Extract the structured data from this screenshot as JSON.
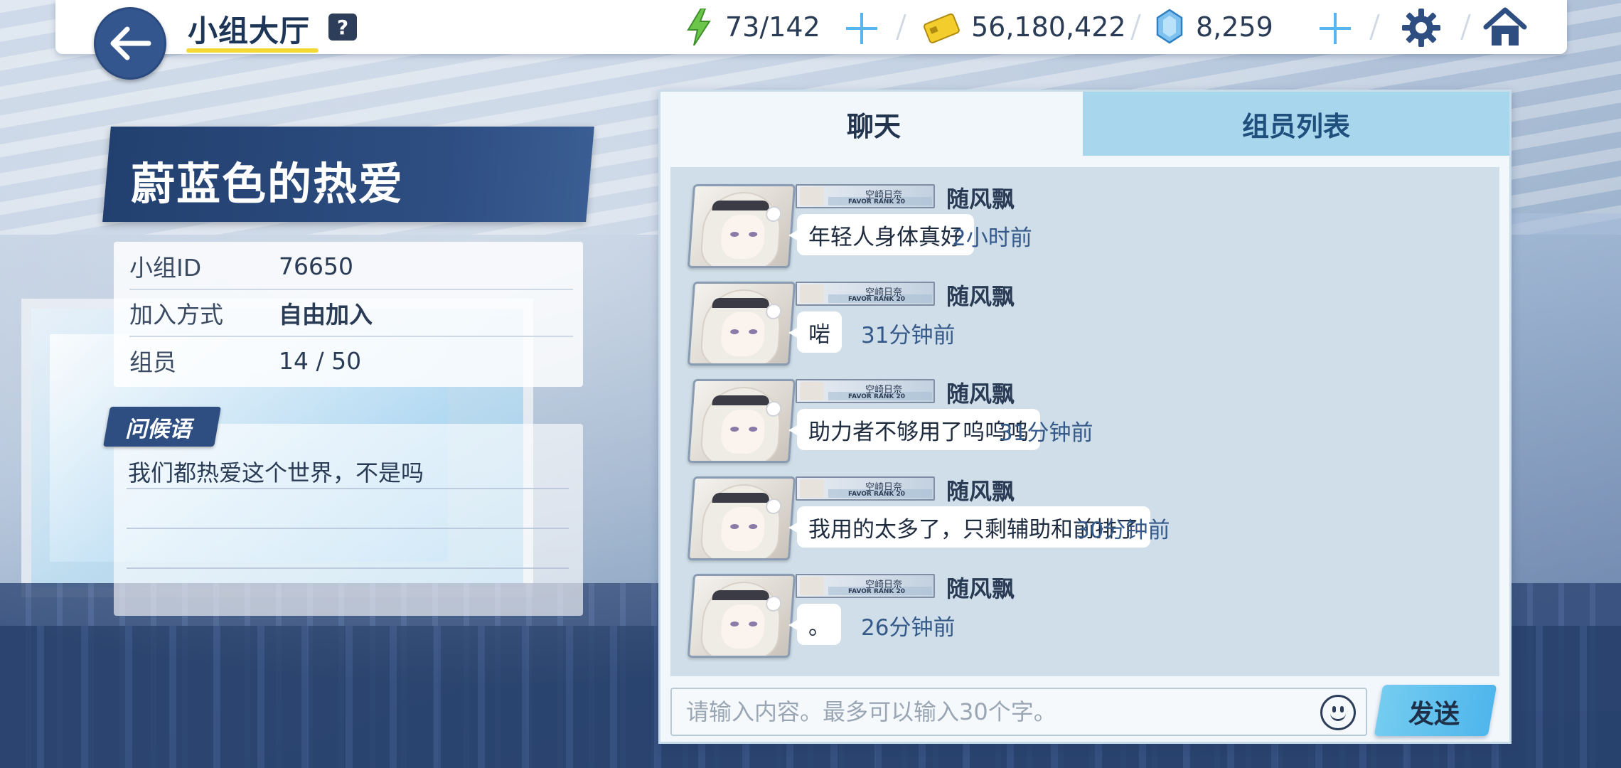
{
  "header": {
    "title": "小组大厅",
    "help_label": "?",
    "stamina": "73/142",
    "credits": "56,180,422",
    "gems": "8,259"
  },
  "icons": {
    "back": "arrow-left-icon",
    "stamina": "lightning-icon",
    "credits": "credit-card-icon",
    "gems": "gem-icon",
    "settings": "gear-icon",
    "home": "home-icon",
    "emoji": "smiley-icon"
  },
  "colors": {
    "accent_navy": "#2e4e82",
    "accent_yellow": "#f4d935",
    "accent_cyan": "#58b5ee",
    "tab_active_bg": "#f2f7fb",
    "tab_inactive_bg": "#a8d6ec"
  },
  "group": {
    "name": "蔚蓝色的热爱",
    "info": [
      {
        "label": "小组ID",
        "value": "76650"
      },
      {
        "label": "加入方式",
        "value": "自由加入"
      },
      {
        "label": "组员",
        "value": "14 / 50"
      }
    ],
    "greeting_tag": "问候语",
    "greeting_text": "我们都热爱这个世界，不是吗"
  },
  "chat": {
    "tabs": [
      {
        "label": "聊天",
        "active": true
      },
      {
        "label": "组员列表",
        "active": false
      }
    ],
    "messages": [
      {
        "badge_top": "空崎日奈",
        "badge_bottom": "FAVOR RANK 20",
        "sender": "随风飘",
        "text": "年轻人身体真好",
        "time": "2小时前"
      },
      {
        "badge_top": "空崎日奈",
        "badge_bottom": "FAVOR RANK 20",
        "sender": "随风飘",
        "text": "啱",
        "time": "31分钟前"
      },
      {
        "badge_top": "空崎日奈",
        "badge_bottom": "FAVOR RANK 20",
        "sender": "随风飘",
        "text": "助力者不够用了呜呜呜",
        "time": "31分钟前"
      },
      {
        "badge_top": "空崎日奈",
        "badge_bottom": "FAVOR RANK 20",
        "sender": "随风飘",
        "text": "我用的太多了，只剩辅助和前排了",
        "time": "30分钟前"
      },
      {
        "badge_top": "空崎日奈",
        "badge_bottom": "FAVOR RANK 20",
        "sender": "随风飘",
        "text": "。",
        "time": "26分钟前"
      }
    ],
    "input_placeholder": "请输入内容。最多可以输入30个字。",
    "send_label": "发送"
  }
}
